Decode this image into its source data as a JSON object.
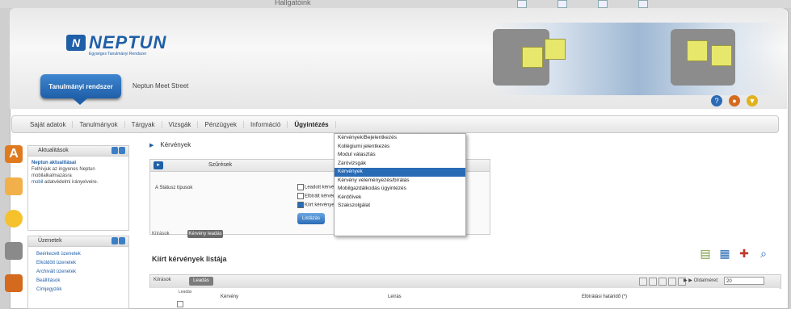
{
  "window": {
    "top_title": "Hallgatóink"
  },
  "header": {
    "logo_mark": "N",
    "logo_text": "NEPTUN",
    "logo_sub": "Egységes Tanulmányi Rendszer",
    "role_active": "Tanulmányi rendszer",
    "role_other": "Neptun Meet Street"
  },
  "menu": {
    "items": [
      "Saját adatok",
      "Tanulmányok",
      "Tárgyak",
      "Vizsgák",
      "Pénzügyek",
      "Információ",
      "Ügyintézés"
    ],
    "active_index": 6
  },
  "dropdown": {
    "items": [
      "Kérvények/Bejelentkezés",
      "Kollégiumi jelentkezés",
      "Modul választás",
      "Záróvizsgák",
      "Kérvények",
      "Kérvény véleményezés/bírálás",
      "Mobilgazdálkodás ügyintézés",
      "Kérdőívek",
      "Szakszolgálat"
    ],
    "selected_index": 4
  },
  "panels": {
    "p1": {
      "title": "Aktualitások",
      "t": "Neptun aktualitásai",
      "body": "Felhívjuk az ingyenes Neptun mobilalkalmazásra",
      "link": "mobil",
      "tail": "adatvédelmi irányelveire."
    },
    "p2": {
      "title": "Üzenetek",
      "items": [
        "Beérkezett üzenetek",
        "Elküldött üzenetek",
        "Archivált üzenetek",
        "Beállítások",
        "Címjegyzék"
      ]
    }
  },
  "main": {
    "breadcrumb": "Kérvények",
    "msg_header": "Szűrések",
    "msg_side": "A Státusz típusok",
    "cb1": "Leadott kérvények",
    "cb2": "Elbírált kérvények",
    "cb3": "Kiírt kérvények",
    "btn": "Listázás",
    "small_label": "Kiírások",
    "small_pill": "Kérvény leadás",
    "list_title": "Kiírt kérvények listája",
    "grid_label": "Kiírások",
    "grid_pill": "Leadás",
    "pager_text": "▶ ▶ Oldalméret:",
    "page_size": "20",
    "col_check": "Leadás",
    "col_name": "Kérvény",
    "col_title": "Leírás",
    "col_deadline": "Elbírálási határidő (*)"
  },
  "colors": {
    "accent": "#1f5fa8",
    "selection": "#2a6bb5"
  }
}
